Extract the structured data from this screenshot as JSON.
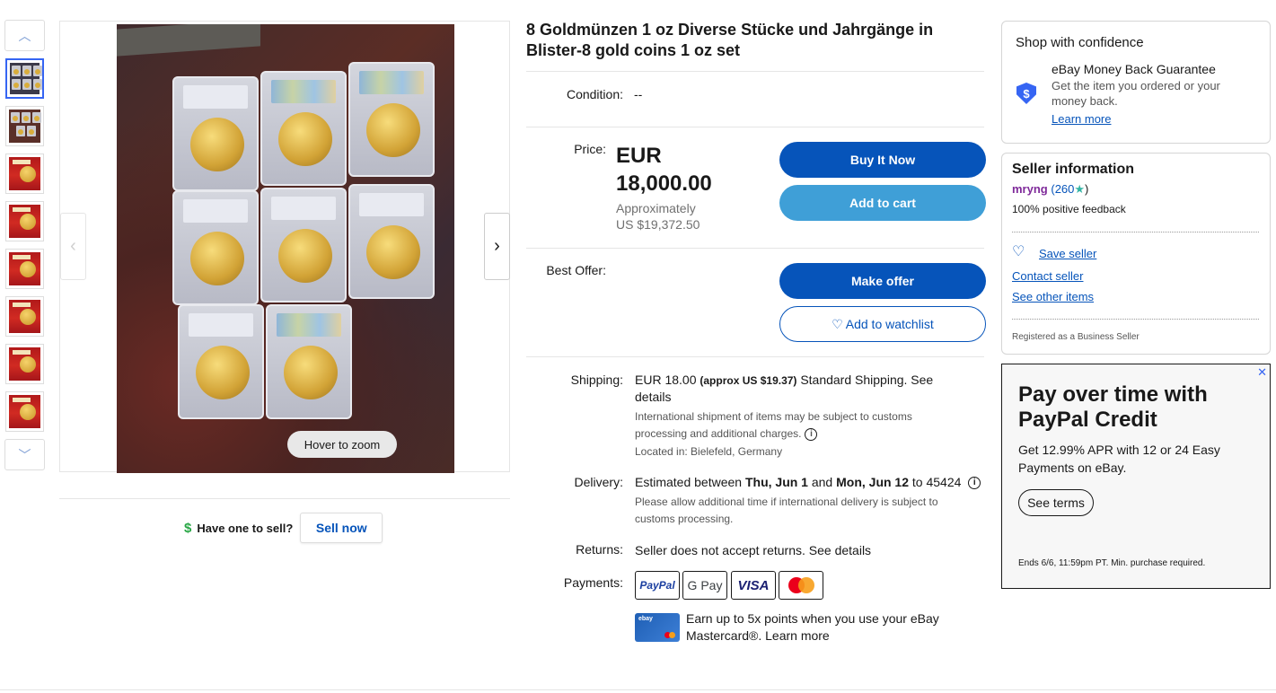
{
  "gallery": {
    "thumb_count": 8,
    "hover_label": "Hover to zoom"
  },
  "sell": {
    "prompt": "Have one to sell?",
    "button": "Sell now"
  },
  "listing": {
    "title": "8 Goldmünzen 1 oz Diverse Stücke und Jahrgänge in Blister-8 gold coins 1 oz set",
    "condition_label": "Condition:",
    "condition_value": "--",
    "price_label": "Price:",
    "price_currency": "EUR",
    "price_amount": "18,000.00",
    "approx_label": "Approximately",
    "approx_value": "US $19,372.50",
    "buy_now": "Buy It Now",
    "add_to_cart": "Add to cart",
    "best_offer_label": "Best Offer:",
    "make_offer": "Make offer",
    "add_to_watchlist": "Add to watchlist",
    "shipping_label": "Shipping:",
    "shipping_price": "EUR 18.00",
    "shipping_approx": "(approx US $19.37)",
    "shipping_method": "Standard Shipping.",
    "shipping_see": "See",
    "shipping_details": "details",
    "intl_note_1": "International shipment of items may be subject to customs",
    "intl_note_2": "processing and additional charges.",
    "located": "Located in: Bielefeld, Germany",
    "delivery_label": "Delivery:",
    "delivery_prefix": "Estimated between",
    "delivery_from": "Thu, Jun 1",
    "delivery_and": "and",
    "delivery_to": "Mon, Jun 12",
    "delivery_zip": "to 45424",
    "delivery_note_1": "Please allow additional time if international delivery is subject to",
    "delivery_note_2": "customs processing.",
    "returns_label": "Returns:",
    "returns_text": "Seller does not accept returns.",
    "returns_link": "See details",
    "payments_label": "Payments:",
    "payment_methods": [
      "PayPal",
      "G Pay",
      "VISA",
      "Mastercard"
    ],
    "card_logo_text": "ebay",
    "card_promo_1": "Earn up to 5x points when you use your eBay",
    "card_promo_2": "Mastercard®.",
    "card_promo_link": "Learn more"
  },
  "confidence": {
    "heading": "Shop with confidence",
    "guarantee_title": "eBay Money Back Guarantee",
    "guarantee_text_1": "Get the item you ordered or your",
    "guarantee_text_2": "money back.",
    "learn_more": "Learn more"
  },
  "seller": {
    "heading": "Seller information",
    "name": "mryng",
    "score": "(260",
    "score_close": ")",
    "feedback": "100% positive feedback",
    "save": "Save seller",
    "contact": "Contact seller",
    "other_items": "See other items",
    "registered": "Registered as a Business Seller"
  },
  "ad": {
    "close": "✕",
    "headline_1": "Pay over time with",
    "headline_2": "PayPal Credit",
    "body_1": "Get 12.99% APR with 12 or 24 Easy",
    "body_2": "Payments on eBay.",
    "cta": "See terms",
    "fine_print": "Ends 6/6, 11:59pm PT. Min. purchase required."
  },
  "colors": {
    "primary_blue": "#0654ba",
    "light_blue": "#3f9fd7",
    "star_teal": "#34b5a5"
  }
}
